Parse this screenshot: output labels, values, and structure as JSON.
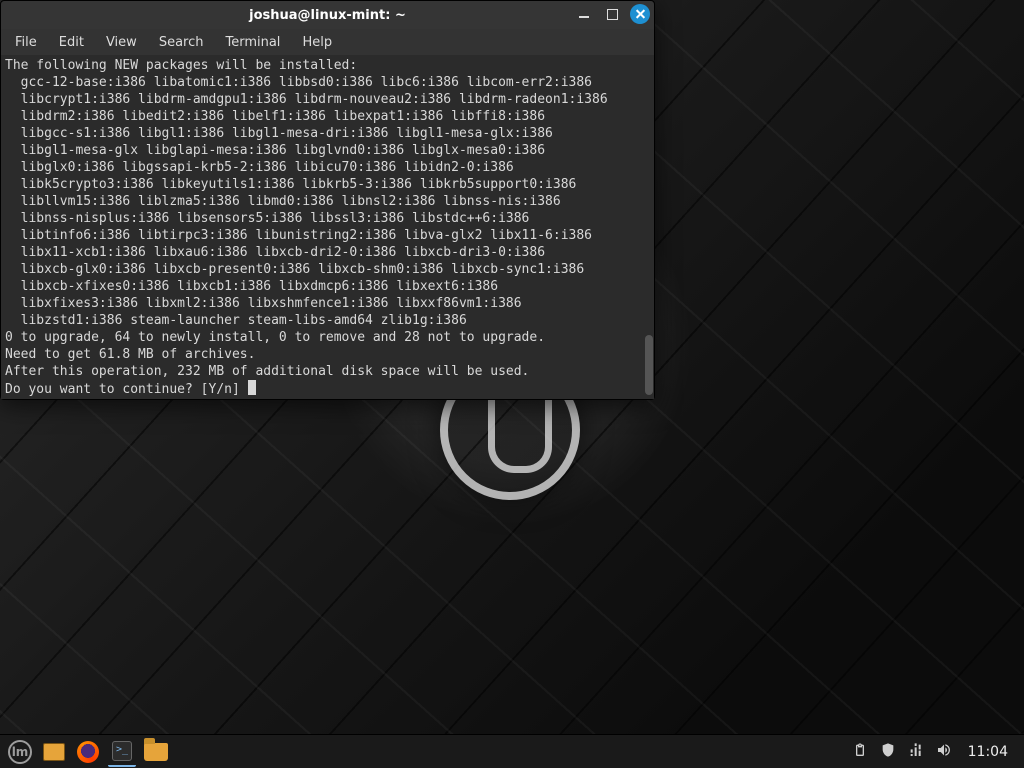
{
  "window": {
    "title": "joshua@linux-mint: ~"
  },
  "menubar": {
    "items": [
      "File",
      "Edit",
      "View",
      "Search",
      "Terminal",
      "Help"
    ]
  },
  "terminal": {
    "lines": [
      "The following NEW packages will be installed:",
      "  gcc-12-base:i386 libatomic1:i386 libbsd0:i386 libc6:i386 libcom-err2:i386",
      "  libcrypt1:i386 libdrm-amdgpu1:i386 libdrm-nouveau2:i386 libdrm-radeon1:i386",
      "  libdrm2:i386 libedit2:i386 libelf1:i386 libexpat1:i386 libffi8:i386",
      "  libgcc-s1:i386 libgl1:i386 libgl1-mesa-dri:i386 libgl1-mesa-glx:i386",
      "  libgl1-mesa-glx libglapi-mesa:i386 libglvnd0:i386 libglx-mesa0:i386",
      "  libglx0:i386 libgssapi-krb5-2:i386 libicu70:i386 libidn2-0:i386",
      "  libk5crypto3:i386 libkeyutils1:i386 libkrb5-3:i386 libkrb5support0:i386",
      "  libllvm15:i386 liblzma5:i386 libmd0:i386 libnsl2:i386 libnss-nis:i386",
      "  libnss-nisplus:i386 libsensors5:i386 libssl3:i386 libstdc++6:i386",
      "  libtinfo6:i386 libtirpc3:i386 libunistring2:i386 libva-glx2 libx11-6:i386",
      "  libx11-xcb1:i386 libxau6:i386 libxcb-dri2-0:i386 libxcb-dri3-0:i386",
      "  libxcb-glx0:i386 libxcb-present0:i386 libxcb-shm0:i386 libxcb-sync1:i386",
      "  libxcb-xfixes0:i386 libxcb1:i386 libxdmcp6:i386 libxext6:i386",
      "  libxfixes3:i386 libxml2:i386 libxshmfence1:i386 libxxf86vm1:i386",
      "  libzstd1:i386 steam-launcher steam-libs-amd64 zlib1g:i386",
      "0 to upgrade, 64 to newly install, 0 to remove and 28 not to upgrade.",
      "Need to get 61.8 MB of archives.",
      "After this operation, 232 MB of additional disk space will be used.",
      "Do you want to continue? [Y/n] "
    ]
  },
  "panel": {
    "clock": "11:04"
  }
}
